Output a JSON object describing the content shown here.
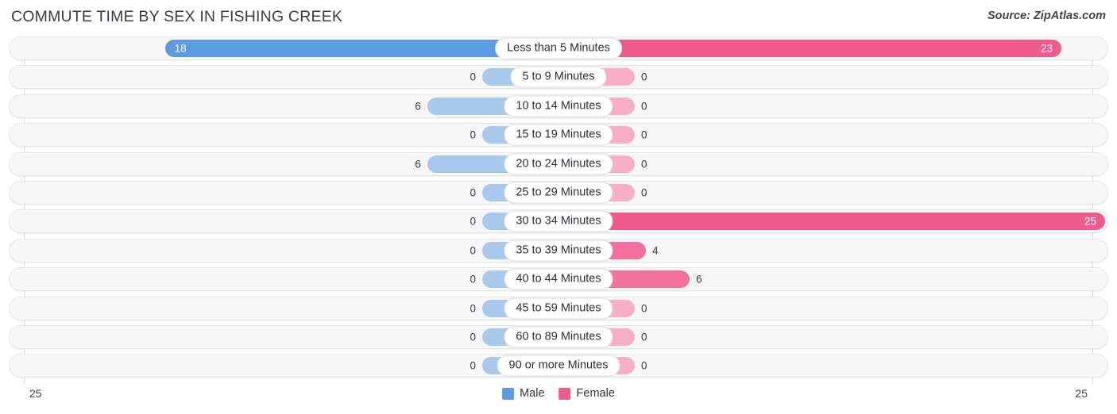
{
  "header": {
    "title": "COMMUTE TIME BY SEX IN FISHING CREEK",
    "source": "Source: ZipAtlas.com"
  },
  "legend": {
    "items": [
      {
        "label": "Male",
        "color": "#5b9bde"
      },
      {
        "label": "Female",
        "color": "#ef5b8c"
      }
    ]
  },
  "axis": {
    "left_tick": "25",
    "right_tick": "25"
  },
  "colors": {
    "male_strong": "#5b9bde",
    "male_light": "#a8c8ec",
    "female_strong": "#f4709e",
    "female_light": "#f8aec7",
    "track_fill": "#f7f7f8",
    "track_border": "#e6e6e9"
  },
  "chart_data": {
    "type": "bar",
    "title": "COMMUTE TIME BY SEX IN FISHING CREEK",
    "subtitle": "",
    "xlabel": "",
    "ylabel": "",
    "orientation": "horizontal-diverging",
    "grid": false,
    "legend_position": "bottom-center",
    "axis_max": 25,
    "xlim": [
      25,
      25
    ],
    "categories": [
      "Less than 5 Minutes",
      "5 to 9 Minutes",
      "10 to 14 Minutes",
      "15 to 19 Minutes",
      "20 to 24 Minutes",
      "25 to 29 Minutes",
      "30 to 34 Minutes",
      "35 to 39 Minutes",
      "40 to 44 Minutes",
      "45 to 59 Minutes",
      "60 to 89 Minutes",
      "90 or more Minutes"
    ],
    "series": [
      {
        "name": "Male",
        "color": "#5b9bde",
        "direction": "left",
        "values": [
          18,
          0,
          6,
          0,
          6,
          0,
          0,
          0,
          0,
          0,
          0,
          0
        ],
        "labels": [
          "18",
          "0",
          "6",
          "0",
          "6",
          "0",
          "0",
          "0",
          "0",
          "0",
          "0",
          "0"
        ]
      },
      {
        "name": "Female",
        "color": "#ef5b8c",
        "direction": "right",
        "values": [
          23,
          0,
          0,
          0,
          0,
          0,
          25,
          4,
          6,
          0,
          0,
          0
        ],
        "labels": [
          "23",
          "0",
          "0",
          "0",
          "0",
          "0",
          "25",
          "4",
          "6",
          "0",
          "0",
          "0"
        ]
      }
    ]
  },
  "rows": [
    {
      "label": "Less than 5 Minutes",
      "male": "18",
      "female": "23"
    },
    {
      "label": "5 to 9 Minutes",
      "male": "0",
      "female": "0"
    },
    {
      "label": "10 to 14 Minutes",
      "male": "6",
      "female": "0"
    },
    {
      "label": "15 to 19 Minutes",
      "male": "0",
      "female": "0"
    },
    {
      "label": "20 to 24 Minutes",
      "male": "6",
      "female": "0"
    },
    {
      "label": "25 to 29 Minutes",
      "male": "0",
      "female": "0"
    },
    {
      "label": "30 to 34 Minutes",
      "male": "0",
      "female": "25"
    },
    {
      "label": "35 to 39 Minutes",
      "male": "0",
      "female": "4"
    },
    {
      "label": "40 to 44 Minutes",
      "male": "0",
      "female": "6"
    },
    {
      "label": "45 to 59 Minutes",
      "male": "0",
      "female": "0"
    },
    {
      "label": "60 to 89 Minutes",
      "male": "0",
      "female": "0"
    },
    {
      "label": "90 or more Minutes",
      "male": "0",
      "female": "0"
    }
  ]
}
